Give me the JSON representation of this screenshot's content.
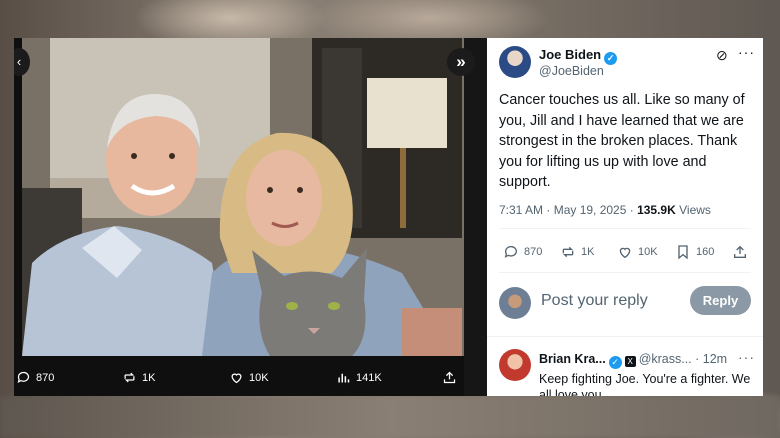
{
  "media": {
    "actions": {
      "replies": "870",
      "reposts": "1K",
      "likes": "10K",
      "views": "141K"
    }
  },
  "tweet": {
    "author": {
      "name": "Joe Biden",
      "handle": "@JoeBiden"
    },
    "text": "Cancer touches us all. Like so many of you, Jill and I have learned that we are strongest in the broken places. Thank you for lifting us up with love and support.",
    "time": "7:31 AM · May 19, 2025 · ",
    "views_count": "135.9K",
    "views_label": " Views",
    "actions": {
      "replies": "870",
      "reposts": "1K",
      "likes": "10K",
      "bookmarks": "160"
    }
  },
  "compose": {
    "placeholder": "Post your reply",
    "button_label": "Reply"
  },
  "reply": {
    "name": "Brian Kra...",
    "handle": "@krass...",
    "time": " · 12m",
    "text": "Keep fighting Joe. You're a fighter. We all love you."
  },
  "colors": {
    "accent": "#1d9bf0",
    "reply_button": "#8b98a5",
    "muted_text": "#536471"
  }
}
